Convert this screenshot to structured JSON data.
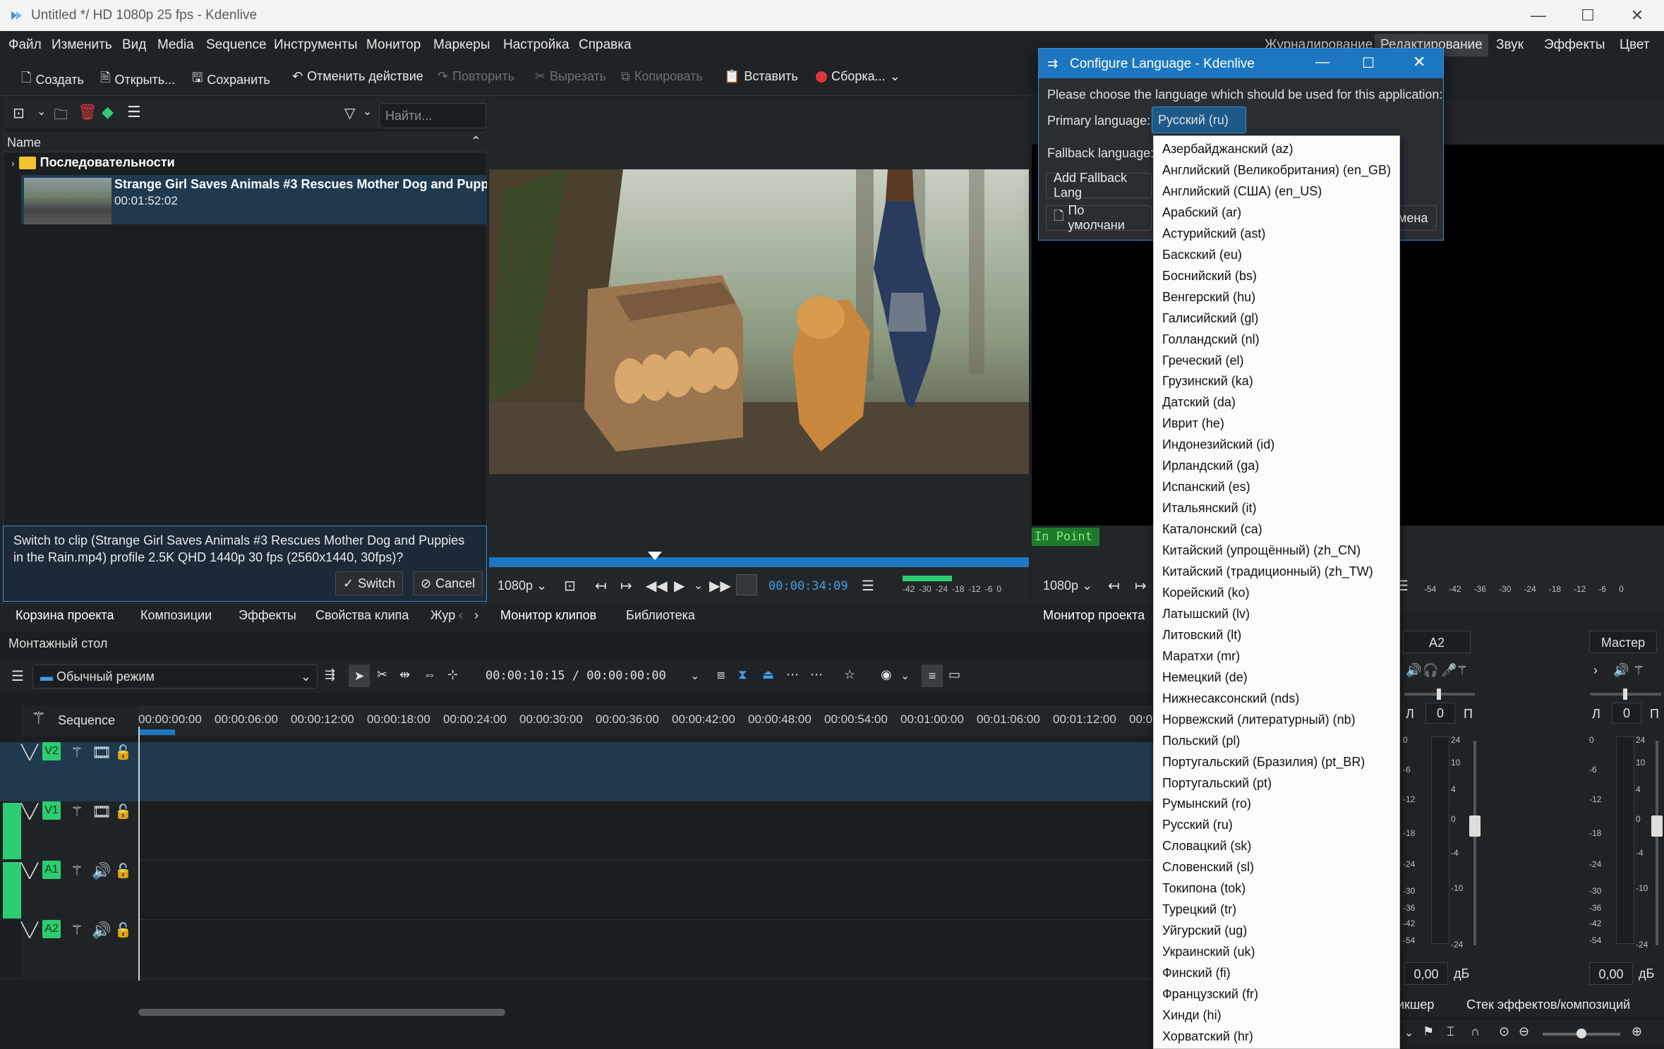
{
  "window": {
    "title": "Untitled */ HD 1080p 25 fps - Kdenlive"
  },
  "menu": [
    "Файл",
    "Изменить",
    "Вид",
    "Media",
    "Sequence",
    "Инструменты",
    "Монитор",
    "Маркеры",
    "Настройка",
    "Справка"
  ],
  "workspaces": [
    "Журналирование",
    "Редактирование",
    "Звук",
    "Эффекты",
    "Цвет"
  ],
  "toolbar": {
    "create": "Создать",
    "open": "Открыть...",
    "save": "Сохранить",
    "undo": "Отменить действие",
    "redo": "Повторить",
    "cut": "Вырезать",
    "copy": "Копировать",
    "paste": "Вставить",
    "render": "Сборка..."
  },
  "bin": {
    "search_placeholder": "Найти...",
    "column": "Name",
    "folder": "Последовательности",
    "clip_name": "Strange Girl Saves Animals #3 Rescues Mother Dog and Puppi",
    "clip_duration": "00:01:52:02"
  },
  "message": {
    "text": "Switch to clip (Strange Girl Saves Animals #3 Rescues Mother Dog and Puppies in the Rain.mp4) profile 2.5K QHD 1440p 30 fps (2560x1440, 30fps)?",
    "switch": "Switch",
    "cancel": "Cancel"
  },
  "left_tabs": [
    "Корзина проекта",
    "Композиции",
    "Эффекты",
    "Свойства клипа",
    "Жур"
  ],
  "clip_monitor": {
    "resolution": "1080p",
    "timecode": "00:00:34:09",
    "tabs": [
      "Монитор клипов",
      "Библиотека"
    ],
    "meter": [
      "-42",
      "-30",
      "-24",
      "-18",
      "-12",
      "-6",
      "0"
    ]
  },
  "project_monitor": {
    "resolution": "1080p",
    "label": "Монитор проекта",
    "in_point": "In Point",
    "meter": [
      "-54",
      "-42",
      "-36",
      "-30",
      "-24",
      "-18",
      "-12",
      "-6",
      "0"
    ]
  },
  "timeline": {
    "title": "Монтажный стол",
    "mode": "Обычный режим",
    "timecode": "00:00:10:15 / 00:00:00:00",
    "sequence": "Sequence",
    "ruler": [
      "00:00:00:00",
      "00:00:06:00",
      "00:00:12:00",
      "00:00:18:00",
      "00:00:24:00",
      "00:00:30:00",
      "00:00:36:00",
      "00:00:42:00",
      "00:00:48:00",
      "00:00:54:00",
      "00:01:00:00",
      "00:01:06:00",
      "00:01:12:00",
      "00:0"
    ],
    "tracks": [
      "V2",
      "V1",
      "A1",
      "A2"
    ]
  },
  "mixer": {
    "channels": [
      {
        "name": "A2",
        "pan": "0",
        "level": "0,00",
        "left": "Л",
        "right": "П"
      },
      {
        "name": "Мастер",
        "pan": "0",
        "level": "0,00",
        "left": "Л",
        "right": "П"
      }
    ],
    "db": "дБ",
    "left_scale": [
      "0",
      "-6",
      "-12",
      "-18",
      "-24",
      "-30",
      "-36",
      "-42",
      "-54"
    ],
    "right_scale": [
      "24",
      "10",
      "4",
      "0",
      "-4",
      "-10",
      "-24"
    ],
    "tabs": [
      "икшер",
      "Стек эффектов/композиций"
    ]
  },
  "dialog": {
    "title": "Configure Language - Kdenlive",
    "prompt": "Please choose the language which should be used for this application:",
    "primary_label": "Primary language:",
    "primary_value": "Русский (ru)",
    "fallback_label": "Fallback language:",
    "add_fallback": "Add Fallback Lang",
    "defaults": "По умолчани",
    "cancel_partial": "мена"
  },
  "languages": [
    "Азербайджанский (az)",
    "Английский (Великобритания) (en_GB)",
    "Английский (США) (en_US)",
    "Арабский (ar)",
    "Астурийский (ast)",
    "Баскский (eu)",
    "Боснийский (bs)",
    "Венгерский (hu)",
    "Галисийский (gl)",
    "Голландский (nl)",
    "Греческий (el)",
    "Грузинский (ka)",
    "Датский (da)",
    "Иврит (he)",
    "Индонезийский (id)",
    "Ирландский (ga)",
    "Испанский (es)",
    "Итальянский (it)",
    "Каталонский (ca)",
    "Китайский (упрощённый) (zh_CN)",
    "Китайский (традиционный) (zh_TW)",
    "Корейский (ko)",
    "Латышский (lv)",
    "Литовский (lt)",
    "Маратхи (mr)",
    "Немецкий (de)",
    "Нижнесаксонский (nds)",
    "Норвежский (литературный) (nb)",
    "Польский (pl)",
    "Португальский (Бразилия) (pt_BR)",
    "Португальский (pt)",
    "Румынский (ro)",
    "Русский (ru)",
    "Словацкий (sk)",
    "Словенский (sl)",
    "Токипона (tok)",
    "Турецкий (tr)",
    "Уйгурский (ug)",
    "Украинский (uk)",
    "Финский (fi)",
    "Французский (fr)",
    "Хинди (hi)",
    "Хорватский (hr)"
  ],
  "colors": {
    "accent": "#1d77c0",
    "track": "#2ecc71",
    "bg": "#202326"
  }
}
